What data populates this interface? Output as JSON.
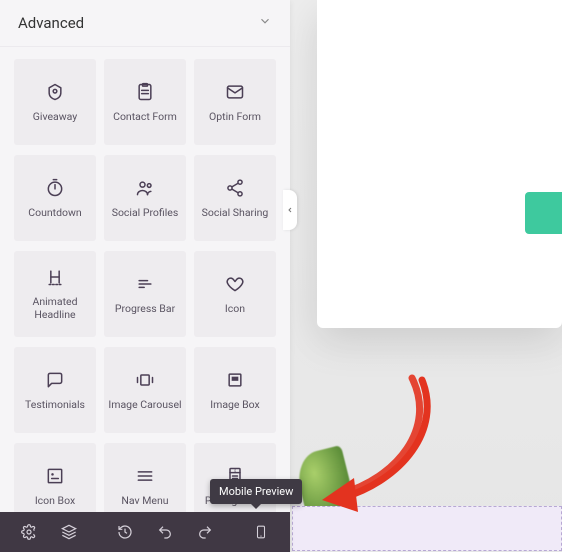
{
  "section": {
    "title": "Advanced"
  },
  "widgets": [
    {
      "key": "giveaway",
      "label": "Giveaway",
      "icon": "gift"
    },
    {
      "key": "contact-form",
      "label": "Contact Form",
      "icon": "form"
    },
    {
      "key": "optin-form",
      "label": "Optin Form",
      "icon": "mail"
    },
    {
      "key": "countdown",
      "label": "Countdown",
      "icon": "timer"
    },
    {
      "key": "social-profiles",
      "label": "Social Profiles",
      "icon": "people"
    },
    {
      "key": "social-sharing",
      "label": "Social Sharing",
      "icon": "share"
    },
    {
      "key": "animated-headline",
      "label": "Animated\nHeadline",
      "icon": "heading"
    },
    {
      "key": "progress-bar",
      "label": "Progress Bar",
      "icon": "progress"
    },
    {
      "key": "icon",
      "label": "Icon",
      "icon": "heart"
    },
    {
      "key": "testimonials",
      "label": "Testimonials",
      "icon": "chat"
    },
    {
      "key": "image-carousel",
      "label": "Image Carousel",
      "icon": "carousel"
    },
    {
      "key": "image-box",
      "label": "Image Box",
      "icon": "imagebox"
    },
    {
      "key": "icon-box",
      "label": "Icon Box",
      "icon": "iconbox"
    },
    {
      "key": "nav-menu",
      "label": "Nav Menu",
      "icon": "menu"
    },
    {
      "key": "pricing-table",
      "label": "Pricing Table",
      "icon": "pricing"
    }
  ],
  "tooltip": {
    "mobile_preview": "Mobile Preview"
  },
  "toolbar": {
    "settings": "settings",
    "layers": "layers",
    "history": "history",
    "undo": "undo",
    "redo": "redo",
    "mobile_preview": "mobile-preview"
  }
}
